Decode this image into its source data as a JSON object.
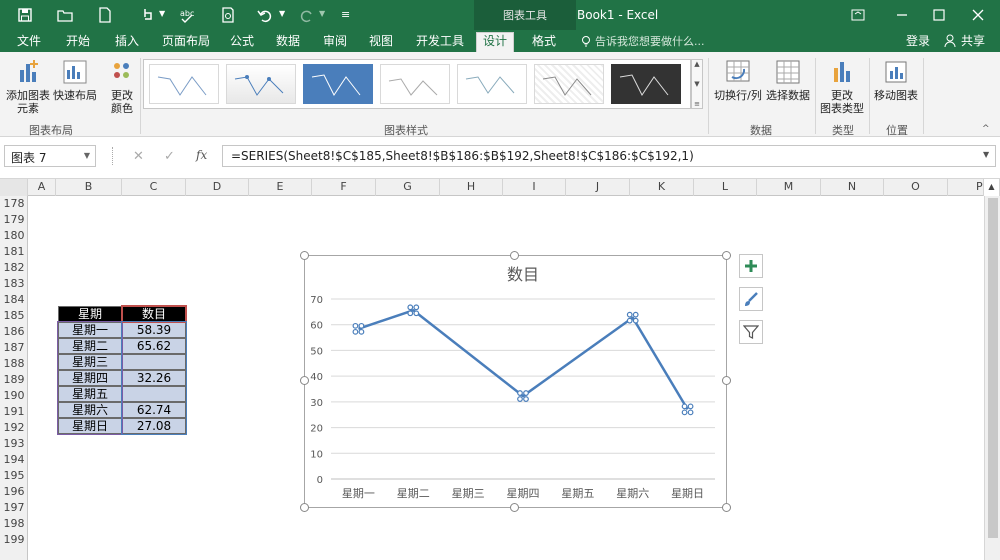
{
  "quick_access": [
    "save-icon",
    "open-icon",
    "new-icon",
    "touch-mode-icon",
    "spell-check-icon",
    "print-preview-icon",
    "undo-icon",
    "redo-icon",
    "customize-icon"
  ],
  "context_tab": "图表工具",
  "window_title": "Book1 - Excel",
  "tabs": [
    "文件",
    "开始",
    "插入",
    "页面布局",
    "公式",
    "数据",
    "审阅",
    "视图",
    "开发工具",
    "设计",
    "格式"
  ],
  "active_tab": "设计",
  "tell_me": "告诉我您想要做什么...",
  "login": "登录",
  "share": "共享",
  "ribbon": {
    "add_element": [
      "添加图表",
      "元素"
    ],
    "quick_layout": "快速布局",
    "change_colors": [
      "更改",
      "颜色"
    ],
    "switch_row_col": "切换行/列",
    "select_data": "选择数据",
    "change_type": [
      "更改",
      "图表类型"
    ],
    "move_chart": "移动图表",
    "groups": [
      "图表布局",
      "图表样式",
      "数据",
      "类型",
      "位置"
    ]
  },
  "name_box": "图表 7",
  "formula": "=SERIES(Sheet8!$C$185,Sheet8!$B$186:$B$192,Sheet8!$C$186:$C$192,1)",
  "columns": [
    "A",
    "B",
    "C",
    "D",
    "E",
    "F",
    "G",
    "H",
    "I",
    "J",
    "K",
    "L",
    "M",
    "N",
    "O",
    "P"
  ],
  "rows": [
    "178",
    "179",
    "180",
    "181",
    "182",
    "183",
    "184",
    "185",
    "186",
    "187",
    "188",
    "189",
    "190",
    "191",
    "192",
    "193",
    "194",
    "195",
    "196",
    "197",
    "198",
    "199"
  ],
  "table": {
    "headers": [
      "星期",
      "数目"
    ],
    "rows": [
      [
        "星期一",
        "58.39"
      ],
      [
        "星期二",
        "65.62"
      ],
      [
        "星期三",
        ""
      ],
      [
        "星期四",
        "32.26"
      ],
      [
        "星期五",
        ""
      ],
      [
        "星期六",
        "62.74"
      ],
      [
        "星期日",
        "27.08"
      ]
    ]
  },
  "colors": {
    "green": "#217346",
    "line": "#4a7ebb",
    "header_bg": "#000000",
    "range_bg": "#c9d3e6"
  },
  "chart_data": {
    "type": "line",
    "title": "数目",
    "categories": [
      "星期一",
      "星期二",
      "星期三",
      "星期四",
      "星期五",
      "星期六",
      "星期日"
    ],
    "series": [
      {
        "name": "数目",
        "values": [
          58.39,
          65.62,
          null,
          32.26,
          null,
          62.74,
          27.08
        ]
      }
    ],
    "ylim": [
      0,
      70
    ],
    "yticks": [
      0,
      10,
      20,
      30,
      40,
      50,
      60,
      70
    ],
    "grid": true,
    "gaps": "connected"
  }
}
